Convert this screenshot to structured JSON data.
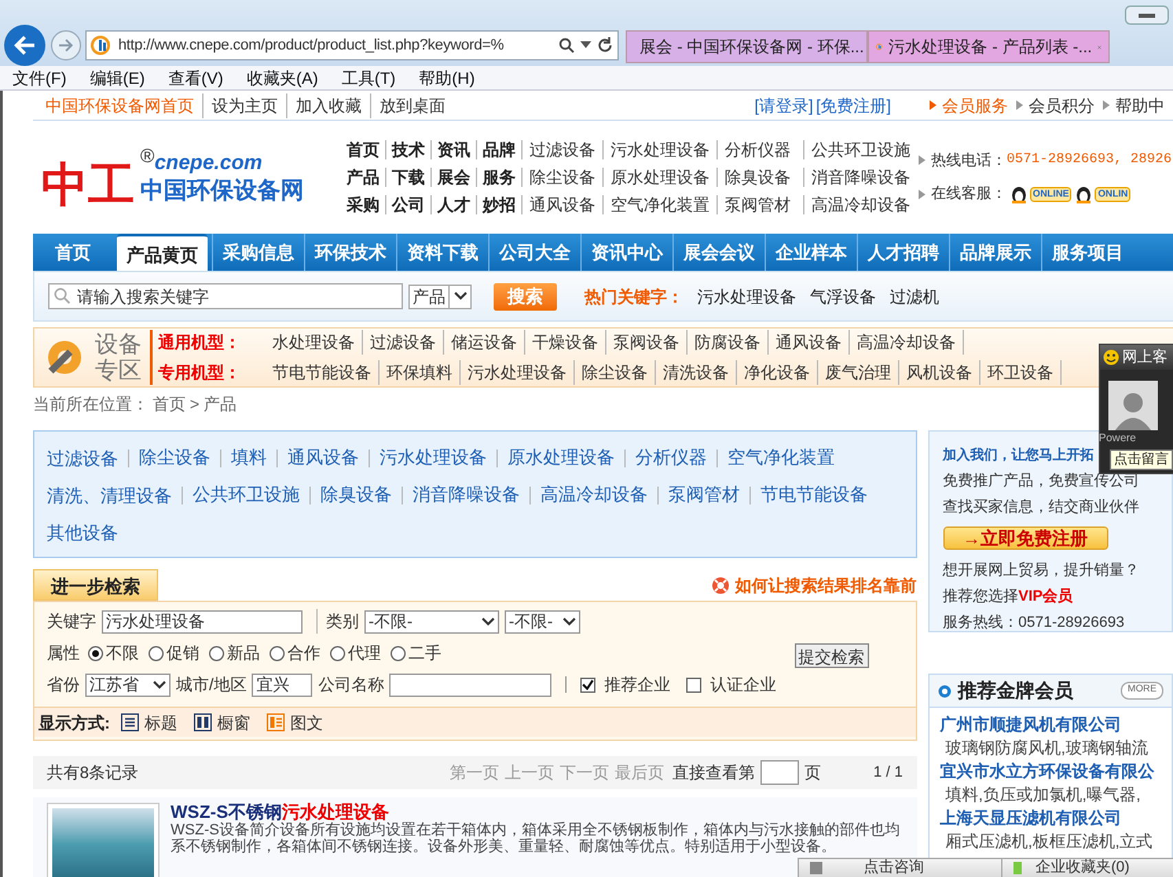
{
  "browser": {
    "address": "http://www.cnepe.com/product/product_list.php?keyword=%",
    "tabs": [
      {
        "title": "展会 - 中国环保设备网 - 环保...",
        "selected": false
      },
      {
        "title": "污水处理设备 - 产品列表 -...",
        "selected": true
      }
    ],
    "menu": [
      "文件(F)",
      "编辑(E)",
      "查看(V)",
      "收藏夹(A)",
      "工具(T)",
      "帮助(H)"
    ]
  },
  "top_links": {
    "left": [
      "中国环保设备网首页",
      "设为主页",
      "加入收藏",
      "放到桌面"
    ],
    "login": [
      "[请登录]",
      "[免费注册]"
    ],
    "right": [
      "会员服务",
      "会员积分",
      "帮助中"
    ]
  },
  "header": {
    "logo_mark": "中工",
    "logo_reg": "®",
    "logo_domain": "cnepe.com",
    "logo_name": "中国环保设备网",
    "quick_links": [
      {
        "main": [
          "首页",
          "技术",
          "资讯",
          "品牌"
        ],
        "sub": [
          "过滤设备",
          "污水处理设备",
          "分析仪器",
          "公共环卫设施"
        ]
      },
      {
        "main": [
          "产品",
          "下载",
          "展会",
          "服务"
        ],
        "sub": [
          "除尘设备",
          "原水处理设备",
          "除臭设备",
          "消音降噪设备"
        ]
      },
      {
        "main": [
          "采购",
          "公司",
          "人才",
          "妙招"
        ],
        "sub": [
          "通风设备",
          "空气净化装置",
          "泵阀管材",
          "高温冷却设备"
        ]
      }
    ],
    "hotline_label": "热线电话：",
    "hotline": "0571-28926693, 28926",
    "online_label": "在线客服：",
    "online_badges": [
      "ONLINE",
      "ONLIN"
    ]
  },
  "nav": [
    {
      "label": "首页",
      "selected": false
    },
    {
      "label": "产品黄页",
      "selected": true
    },
    {
      "label": "采购信息",
      "selected": false
    },
    {
      "label": "环保技术",
      "selected": false
    },
    {
      "label": "资料下载",
      "selected": false
    },
    {
      "label": "公司大全",
      "selected": false
    },
    {
      "label": "资讯中心",
      "selected": false
    },
    {
      "label": "展会会议",
      "selected": false
    },
    {
      "label": "企业样本",
      "selected": false
    },
    {
      "label": "人才招聘",
      "selected": false
    },
    {
      "label": "品牌展示",
      "selected": false
    },
    {
      "label": "服务项目",
      "selected": false
    }
  ],
  "search": {
    "placeholder": "请输入搜索关键字",
    "scope": "产品",
    "button": "搜索",
    "hot_label": "热门关键字：",
    "hot": [
      "污水处理设备",
      "气浮设备",
      "过滤机"
    ]
  },
  "zone": {
    "title": [
      "设备",
      "专区"
    ],
    "rows": [
      {
        "label": "通用机型：",
        "items": [
          "水处理设备",
          "过滤设备",
          "储运设备",
          "干燥设备",
          "泵阀设备",
          "防腐设备",
          "通风设备",
          "高温冷却设备"
        ]
      },
      {
        "label": "专用机型：",
        "items": [
          "节电节能设备",
          "环保填料",
          "污水处理设备",
          "除尘设备",
          "清洗设备",
          "净化设备",
          "废气治理",
          "风机设备",
          "环卫设备"
        ]
      }
    ]
  },
  "breadcrumb": [
    "当前所在位置：",
    "首页",
    ">",
    "产品"
  ],
  "categories": [
    "过滤设备",
    "除尘设备",
    "填料",
    "通风设备",
    "污水处理设备",
    "原水处理设备",
    "分析仪器",
    "空气净化装置",
    "清洗、清理设备",
    "公共环卫设施",
    "除臭设备",
    "消音降噪设备",
    "高温冷却设备",
    "泵阀管材",
    "节电节能设备",
    "其他设备"
  ],
  "advanced": {
    "tab": "进一步检索",
    "help_link": "如何让搜索结果排名靠前",
    "keyword_label": "关键字",
    "keyword": "污水处理设备",
    "category_label": "类别",
    "category_selects": [
      "-不限-",
      "-不限-"
    ],
    "attr_label": "属性",
    "attrs": [
      {
        "label": "不限",
        "selected": true
      },
      {
        "label": "促销",
        "selected": false
      },
      {
        "label": "新品",
        "selected": false
      },
      {
        "label": "合作",
        "selected": false
      },
      {
        "label": "代理",
        "selected": false
      },
      {
        "label": "二手",
        "selected": false
      }
    ],
    "submit": "提交检索",
    "province_label": "省份",
    "province": "江苏省",
    "city_label": "城市/地区",
    "city": "宜兴",
    "company_label": "公司名称",
    "checks": [
      {
        "label": "推荐企业",
        "checked": true
      },
      {
        "label": "认证企业",
        "checked": false
      }
    ],
    "display_label": "显示方式:",
    "display_modes": [
      {
        "label": "标题",
        "kind": "list",
        "selected": false
      },
      {
        "label": "橱窗",
        "kind": "grid",
        "selected": false
      },
      {
        "label": "图文",
        "kind": "detail",
        "selected": true
      }
    ]
  },
  "results": {
    "count": "共有8条记录",
    "pager": [
      {
        "label": "第一页",
        "disabled": true
      },
      {
        "label": "上一页",
        "disabled": true
      },
      {
        "label": "下一页",
        "disabled": true
      },
      {
        "label": "最后页",
        "disabled": true
      }
    ],
    "goto_label": "直接查看第",
    "goto_unit": "页",
    "page": "1 / 1"
  },
  "products": [
    {
      "title": "WSZ-S不锈钢",
      "title_highlight": "污水处理设备",
      "description": "WSZ-S设备简介设备所有设施均设置在若干箱体内，箱体采用全不锈钢板制作，箱体内与污水接触的部件也均系不锈钢制作，各箱体间不锈钢连接。设备外形美、重量轻、耐腐蚀等优点。特别适用于小型设备。"
    }
  ],
  "join": {
    "title": "加入我们，让您马上开拓",
    "lines": [
      "免费推广产品，免费宣传公司",
      "查找买家信息，结交商业伙伴"
    ],
    "button": "→立即免费注册",
    "trade_line": "想开展网上贸易，提升销量？",
    "vip_line": "推荐您选择",
    "vip": "VIP会员",
    "service_line": "服务热线：0571-28926693"
  },
  "gold": {
    "title": "推荐金牌会员",
    "more": "MORE",
    "members": [
      {
        "name": "广州市顺捷风机有限公司",
        "desc": "玻璃钢防腐风机,玻璃钢轴流"
      },
      {
        "name": "宜兴市水立方环保设备有限公",
        "desc": "填料,负压或加氯机,曝气器,"
      },
      {
        "name": "上海天显压滤机有限公司",
        "desc": "厢式压滤机,板框压滤机,立式"
      }
    ]
  },
  "chat": {
    "title": "网上客",
    "tooltip": "点击留言",
    "powered": "Powere"
  },
  "bottom_bar": {
    "consult": "点击咨询",
    "favorites": "企业收藏夹(0)"
  }
}
